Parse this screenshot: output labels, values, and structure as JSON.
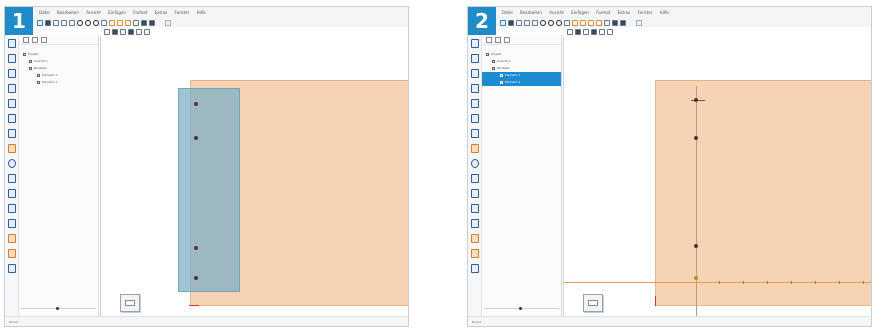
{
  "panels": [
    {
      "badge": "1",
      "menu": [
        "Datei",
        "Bearbeiten",
        "Ansicht",
        "Einfügen",
        "Format",
        "Extras",
        "Fenster",
        "Hilfe"
      ],
      "tree": [
        {
          "label": "Projekt",
          "selected": false
        },
        {
          "label": "Ansicht 1",
          "selected": false
        },
        {
          "label": "Bauteile",
          "selected": false
        },
        {
          "label": "Element 1",
          "selected": false
        },
        {
          "label": "Element 2",
          "selected": false
        }
      ],
      "status": "Bereit"
    },
    {
      "badge": "2",
      "menu": [
        "Datei",
        "Bearbeiten",
        "Ansicht",
        "Einfügen",
        "Format",
        "Extras",
        "Fenster",
        "Hilfe"
      ],
      "tree": [
        {
          "label": "Projekt",
          "selected": false
        },
        {
          "label": "Ansicht 1",
          "selected": false
        },
        {
          "label": "Bauteile",
          "selected": false
        },
        {
          "label": "Element 1",
          "selected": true
        },
        {
          "label": "Element 2",
          "selected": true
        }
      ],
      "status": "Bereit"
    }
  ],
  "colors": {
    "badge": "#1f8cc7",
    "plate": "#f6d3b4",
    "selection": "#78afc8",
    "guide": "#e99a55",
    "tree_selected": "#1d8ad1"
  },
  "icons": [
    "new-file-icon",
    "open-icon",
    "save-icon",
    "undo-icon",
    "redo-icon",
    "circle-tool-icon",
    "zoom-icon",
    "select-icon",
    "move-icon",
    "rotate-icon",
    "measure-icon"
  ]
}
